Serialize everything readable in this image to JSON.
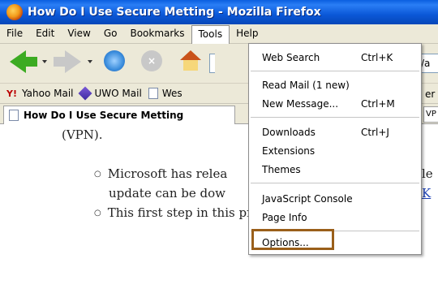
{
  "window": {
    "title": "How Do I Use Secure Metting - Mozilla Firefox"
  },
  "menubar": {
    "items": [
      {
        "label": "File"
      },
      {
        "label": "Edit"
      },
      {
        "label": "View"
      },
      {
        "label": "Go"
      },
      {
        "label": "Bookmarks"
      },
      {
        "label": "Tools"
      },
      {
        "label": "Help"
      }
    ]
  },
  "toolbar": {
    "url_fragment": "di/a"
  },
  "bookmarks": {
    "items": [
      {
        "label": "Yahoo Mail"
      },
      {
        "label": "UWO Mail"
      },
      {
        "label": "Wes"
      }
    ],
    "overflow_text": "er"
  },
  "tabs": {
    "active_label": "How Do I Use Secure Metting",
    "right_fragment": "VP"
  },
  "content": {
    "line1": "(VPN).",
    "line2": "Microsoft has relea",
    "line2_right": "le",
    "line3": "update can be dow",
    "line3_link": "K",
    "line4": "This first step in this process requires that you log"
  },
  "tools_menu": {
    "items": [
      {
        "label": "Web Search",
        "shortcut": "Ctrl+K"
      },
      {
        "label": "Read Mail (1 new)",
        "shortcut": ""
      },
      {
        "label": "New Message...",
        "shortcut": "Ctrl+M"
      },
      {
        "label": "Downloads",
        "shortcut": "Ctrl+J"
      },
      {
        "label": "Extensions",
        "shortcut": ""
      },
      {
        "label": "Themes",
        "shortcut": ""
      },
      {
        "label": "JavaScript Console",
        "shortcut": ""
      },
      {
        "label": "Page Info",
        "shortcut": ""
      },
      {
        "label": "Options...",
        "shortcut": ""
      }
    ]
  },
  "colors": {
    "highlight_box": "#9a5f1a",
    "titlebar": "#0b58d8"
  }
}
